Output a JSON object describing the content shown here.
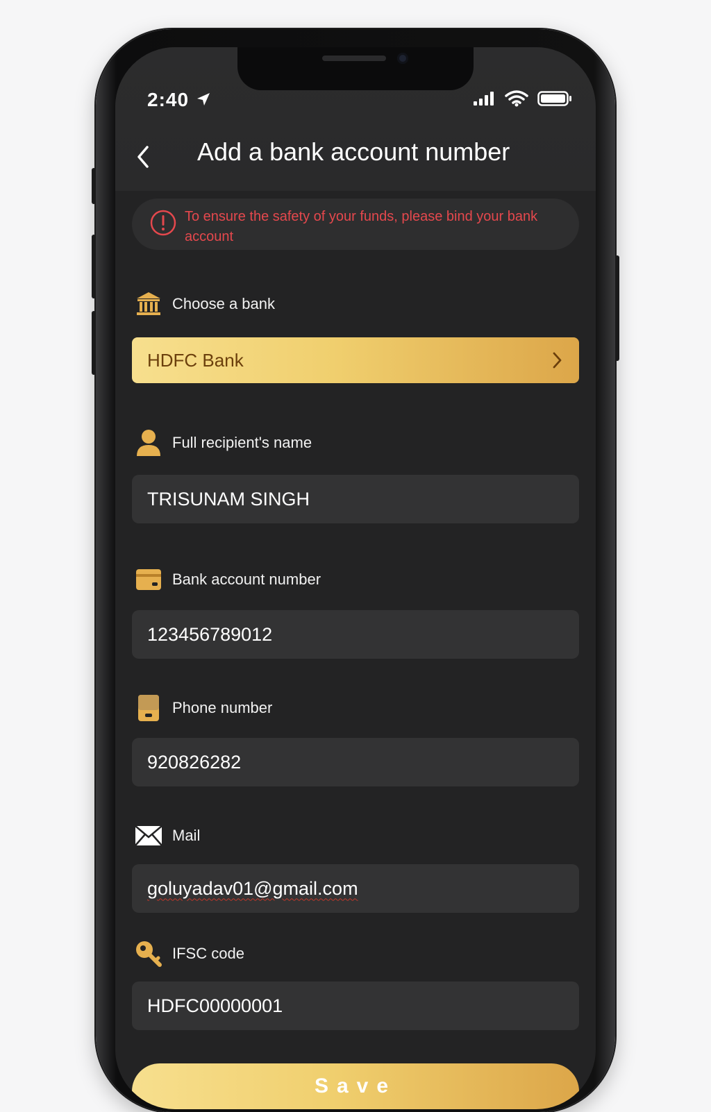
{
  "status_bar": {
    "time": "2:40",
    "icons": [
      "location-arrow-icon",
      "signal-icon",
      "wifi-icon",
      "battery-icon"
    ]
  },
  "header": {
    "back_icon": "chevron-left-icon",
    "title": "Add a bank account number"
  },
  "alert": {
    "icon": "exclamation-circle-icon",
    "text": "To ensure the safety of your funds, please bind your bank account",
    "color": "#e5484d"
  },
  "form": {
    "bank": {
      "label": "Choose a bank",
      "icon": "bank-icon",
      "value": "HDFC Bank",
      "chevron": "chevron-right-icon"
    },
    "name": {
      "label": "Full recipient's name",
      "icon": "user-icon",
      "value": "TRISUNAM SINGH"
    },
    "account": {
      "label": "Bank account number",
      "icon": "card-icon",
      "value": "123456789012"
    },
    "phone": {
      "label": "Phone number",
      "icon": "phone-icon",
      "value": "920826282"
    },
    "mail": {
      "label": "Mail",
      "icon": "envelope-icon",
      "value": "goluyadav01@gmail.com"
    },
    "ifsc": {
      "label": "IFSC code",
      "icon": "key-icon",
      "value": "HDFC00000001"
    }
  },
  "save_button": {
    "label": "Save"
  },
  "colors": {
    "accent_gold": "#f0cf6e",
    "accent_gold_dark": "#dca649",
    "background": "#232324",
    "field_bg": "#333334"
  }
}
